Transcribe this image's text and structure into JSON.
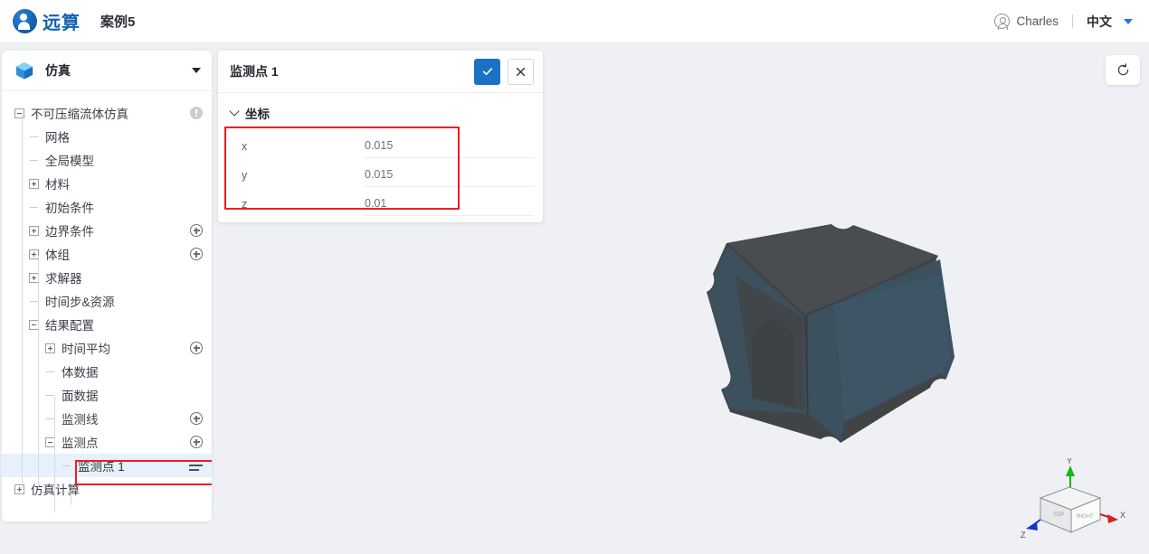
{
  "topbar": {
    "brand": "远算",
    "case_title": "案例5",
    "user_name": "Charles",
    "language": "中文",
    "logo_icon": "yuansuan-logo-icon",
    "avatar_icon": "user-circle-icon",
    "lang_caret_icon": "chevron-down-icon",
    "accent_blue": "#1a7ae0",
    "brand_blue": "#1361ae"
  },
  "sidebar": {
    "header": {
      "label": "仿真",
      "icon": "cube-icon",
      "caret_icon": "chevron-down-icon"
    },
    "tree": [
      {
        "label": "不可压缩流体仿真",
        "toggle": "minus",
        "indent": 0,
        "badge": "info"
      },
      {
        "label": "网格",
        "toggle": "leaf",
        "indent": 1,
        "badge": "none"
      },
      {
        "label": "全局模型",
        "toggle": "leaf",
        "indent": 1,
        "badge": "none"
      },
      {
        "label": "材料",
        "toggle": "plus",
        "indent": 1,
        "badge": "none"
      },
      {
        "label": "初始条件",
        "toggle": "leaf",
        "indent": 1,
        "badge": "none"
      },
      {
        "label": "边界条件",
        "toggle": "plus",
        "indent": 1,
        "badge": "add"
      },
      {
        "label": "体组",
        "toggle": "plus",
        "indent": 1,
        "badge": "add"
      },
      {
        "label": "求解器",
        "toggle": "plus",
        "indent": 1,
        "badge": "none"
      },
      {
        "label": "时间步&资源",
        "toggle": "leaf",
        "indent": 1,
        "badge": "none"
      },
      {
        "label": "结果配置",
        "toggle": "minus",
        "indent": 1,
        "badge": "none"
      },
      {
        "label": "时间平均",
        "toggle": "plus",
        "indent": 2,
        "badge": "add"
      },
      {
        "label": "体数据",
        "toggle": "leaf",
        "indent": 2,
        "badge": "none"
      },
      {
        "label": "面数据",
        "toggle": "leaf",
        "indent": 2,
        "badge": "none"
      },
      {
        "label": "监测线",
        "toggle": "leaf",
        "indent": 2,
        "badge": "add"
      },
      {
        "label": "监测点",
        "toggle": "minus",
        "indent": 2,
        "badge": "add"
      },
      {
        "label": "监测点 1",
        "toggle": "leaf",
        "indent": 3,
        "badge": "list",
        "selected": true
      },
      {
        "label": "仿真计算",
        "toggle": "plus",
        "indent": 0,
        "badge": "none"
      }
    ]
  },
  "properties": {
    "title": "监测点 1",
    "confirm_icon": "check-icon",
    "cancel_icon": "close-icon",
    "section": {
      "label": "坐标",
      "chevron_icon": "chevron-down-icon"
    },
    "fields": [
      {
        "label": "x",
        "value": "0.015"
      },
      {
        "label": "y",
        "value": "0.015"
      },
      {
        "label": "z",
        "value": "0.01"
      }
    ]
  },
  "viewport": {
    "reset_icon": "reset-view-icon",
    "gizmo": {
      "axis_x": "X",
      "axis_y": "Y",
      "axis_z": "Z",
      "face_top": "TOP",
      "face_right": "RIGHT",
      "color_x": "#d21f1f",
      "color_y": "#14b814",
      "color_z": "#1533d2"
    },
    "model_colors": {
      "body": "#414447",
      "face": "#3e525e"
    }
  },
  "annotations": {
    "accent": "#ee1c25",
    "boxes": [
      {
        "name": "coords-highlight"
      },
      {
        "name": "monitor-point-item-highlight"
      }
    ]
  }
}
